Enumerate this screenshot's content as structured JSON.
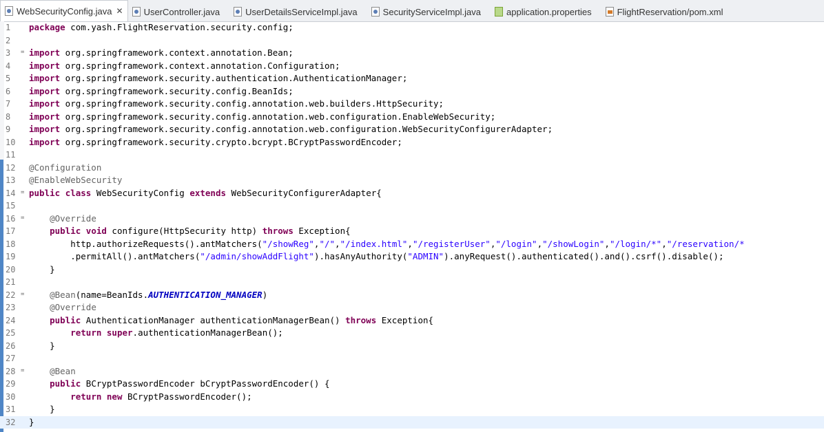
{
  "tabs": [
    {
      "label": "WebSecurityConfig.java",
      "icon": "java-file-icon",
      "active": true,
      "closable": true
    },
    {
      "label": "UserController.java",
      "icon": "java-file-icon",
      "active": false
    },
    {
      "label": "UserDetailsServiceImpl.java",
      "icon": "java-file-icon",
      "active": false
    },
    {
      "label": "SecurityServiceImpl.java",
      "icon": "java-file-icon",
      "active": false
    },
    {
      "label": "application.properties",
      "icon": "properties-file-icon",
      "active": false
    },
    {
      "label": "FlightReservation/pom.xml",
      "icon": "xml-file-icon",
      "active": false
    }
  ],
  "editor": {
    "current_line": 32,
    "lines": [
      {
        "n": "1",
        "t": [
          [
            "kw",
            "package"
          ],
          [
            "",
            "com.yash.FlightReservation.security.config;"
          ]
        ]
      },
      {
        "n": "2",
        "t": []
      },
      {
        "n": "3",
        "t": [
          [
            "kw",
            "import"
          ],
          [
            "",
            " org.springframework.context.annotation.Bean;"
          ]
        ]
      },
      {
        "n": "4",
        "t": [
          [
            "kw",
            "import"
          ],
          [
            "",
            " org.springframework.context.annotation.Configuration;"
          ]
        ]
      },
      {
        "n": "5",
        "t": [
          [
            "kw",
            "import"
          ],
          [
            "",
            " org.springframework.security.authentication.AuthenticationManager;"
          ]
        ]
      },
      {
        "n": "6",
        "t": [
          [
            "kw",
            "import"
          ],
          [
            "",
            " org.springframework.security.config.BeanIds;"
          ]
        ]
      },
      {
        "n": "7",
        "t": [
          [
            "kw",
            "import"
          ],
          [
            "",
            " org.springframework.security.config.annotation.web.builders.HttpSecurity;"
          ]
        ]
      },
      {
        "n": "8",
        "t": [
          [
            "kw",
            "import"
          ],
          [
            "",
            " org.springframework.security.config.annotation.web.configuration.EnableWebSecurity;"
          ]
        ]
      },
      {
        "n": "9",
        "t": [
          [
            "kw",
            "import"
          ],
          [
            "",
            " org.springframework.security.config.annotation.web.configuration.WebSecurityConfigurerAdapter;"
          ]
        ]
      },
      {
        "n": "10",
        "t": [
          [
            "kw",
            "import"
          ],
          [
            "",
            " org.springframework.security.crypto.bcrypt.BCryptPasswordEncoder;"
          ]
        ]
      },
      {
        "n": "11",
        "t": []
      },
      {
        "n": "12",
        "t": [
          [
            "ann",
            "@Configuration"
          ]
        ]
      },
      {
        "n": "13",
        "t": [
          [
            "ann",
            "@EnableWebSecurity"
          ]
        ]
      },
      {
        "n": "14",
        "t": [
          [
            "kw",
            "public"
          ],
          [
            "",
            " "
          ],
          [
            "kw",
            "class"
          ],
          [
            "",
            " WebSecurityConfig "
          ],
          [
            "kw",
            "extends"
          ],
          [
            "",
            " WebSecurityConfigurerAdapter{"
          ]
        ]
      },
      {
        "n": "15",
        "t": []
      },
      {
        "n": "16",
        "t": [
          [
            "",
            "    "
          ],
          [
            "ann",
            "@Override"
          ]
        ]
      },
      {
        "n": "17",
        "t": [
          [
            "",
            "    "
          ],
          [
            "kw",
            "public"
          ],
          [
            "",
            " "
          ],
          [
            "kw",
            "void"
          ],
          [
            "",
            " configure(HttpSecurity http) "
          ],
          [
            "kw",
            "throws"
          ],
          [
            "",
            " Exception{"
          ]
        ]
      },
      {
        "n": "18",
        "t": [
          [
            "",
            "        http.authorizeRequests().antMatchers("
          ],
          [
            "str",
            "\"/showReg\""
          ],
          [
            "",
            ","
          ],
          [
            "str",
            "\"/\""
          ],
          [
            "",
            ","
          ],
          [
            "str",
            "\"/index.html\""
          ],
          [
            "",
            ","
          ],
          [
            "str",
            "\"/registerUser\""
          ],
          [
            "",
            ","
          ],
          [
            "str",
            "\"/login\""
          ],
          [
            "",
            ","
          ],
          [
            "str",
            "\"/showLogin\""
          ],
          [
            "",
            ","
          ],
          [
            "str",
            "\"/login/*\""
          ],
          [
            "",
            ","
          ],
          [
            "str",
            "\"/reservation/*"
          ]
        ]
      },
      {
        "n": "19",
        "t": [
          [
            "",
            "        .permitAll().antMatchers("
          ],
          [
            "str",
            "\"/admin/showAddFlight\""
          ],
          [
            "",
            ").hasAnyAuthority("
          ],
          [
            "str",
            "\"ADMIN\""
          ],
          [
            "",
            ").anyRequest().authenticated().and().csrf().disable();"
          ]
        ]
      },
      {
        "n": "20",
        "t": [
          [
            "",
            "    }"
          ]
        ]
      },
      {
        "n": "21",
        "t": []
      },
      {
        "n": "22",
        "t": [
          [
            "",
            "    "
          ],
          [
            "ann",
            "@Bean"
          ],
          [
            "",
            "(name=BeanIds."
          ],
          [
            "const",
            "AUTHENTICATION_MANAGER"
          ],
          [
            "",
            ")"
          ]
        ]
      },
      {
        "n": "23",
        "t": [
          [
            "",
            "    "
          ],
          [
            "ann",
            "@Override"
          ]
        ]
      },
      {
        "n": "24",
        "t": [
          [
            "",
            "    "
          ],
          [
            "kw",
            "public"
          ],
          [
            "",
            " AuthenticationManager authenticationManagerBean() "
          ],
          [
            "kw",
            "throws"
          ],
          [
            "",
            " Exception{"
          ]
        ]
      },
      {
        "n": "25",
        "t": [
          [
            "",
            "        "
          ],
          [
            "kw",
            "return"
          ],
          [
            "",
            " "
          ],
          [
            "kw",
            "super"
          ],
          [
            "",
            ".authenticationManagerBean();"
          ]
        ]
      },
      {
        "n": "26",
        "t": [
          [
            "",
            "    }"
          ]
        ]
      },
      {
        "n": "27",
        "t": []
      },
      {
        "n": "28",
        "t": [
          [
            "",
            "    "
          ],
          [
            "ann",
            "@Bean"
          ]
        ]
      },
      {
        "n": "29",
        "t": [
          [
            "",
            "    "
          ],
          [
            "kw",
            "public"
          ],
          [
            "",
            " BCryptPasswordEncoder bCryptPasswordEncoder() {"
          ]
        ]
      },
      {
        "n": "30",
        "t": [
          [
            "",
            "        "
          ],
          [
            "kw",
            "return"
          ],
          [
            "",
            " "
          ],
          [
            "kw",
            "new"
          ],
          [
            "",
            " BCryptPasswordEncoder();"
          ]
        ]
      },
      {
        "n": "31",
        "t": [
          [
            "",
            "    }"
          ]
        ]
      },
      {
        "n": "32",
        "t": [
          [
            "",
            "}"
          ]
        ]
      }
    ],
    "fold_marks": {
      "3": "=",
      "14": "=",
      "16": "=",
      "22": "=",
      "28": "="
    }
  },
  "colors": {
    "keyword": "#7f0055",
    "annotation": "#646464",
    "string": "#2a00ff",
    "constant": "#0000c0",
    "current_line": "#e8f2fe"
  }
}
